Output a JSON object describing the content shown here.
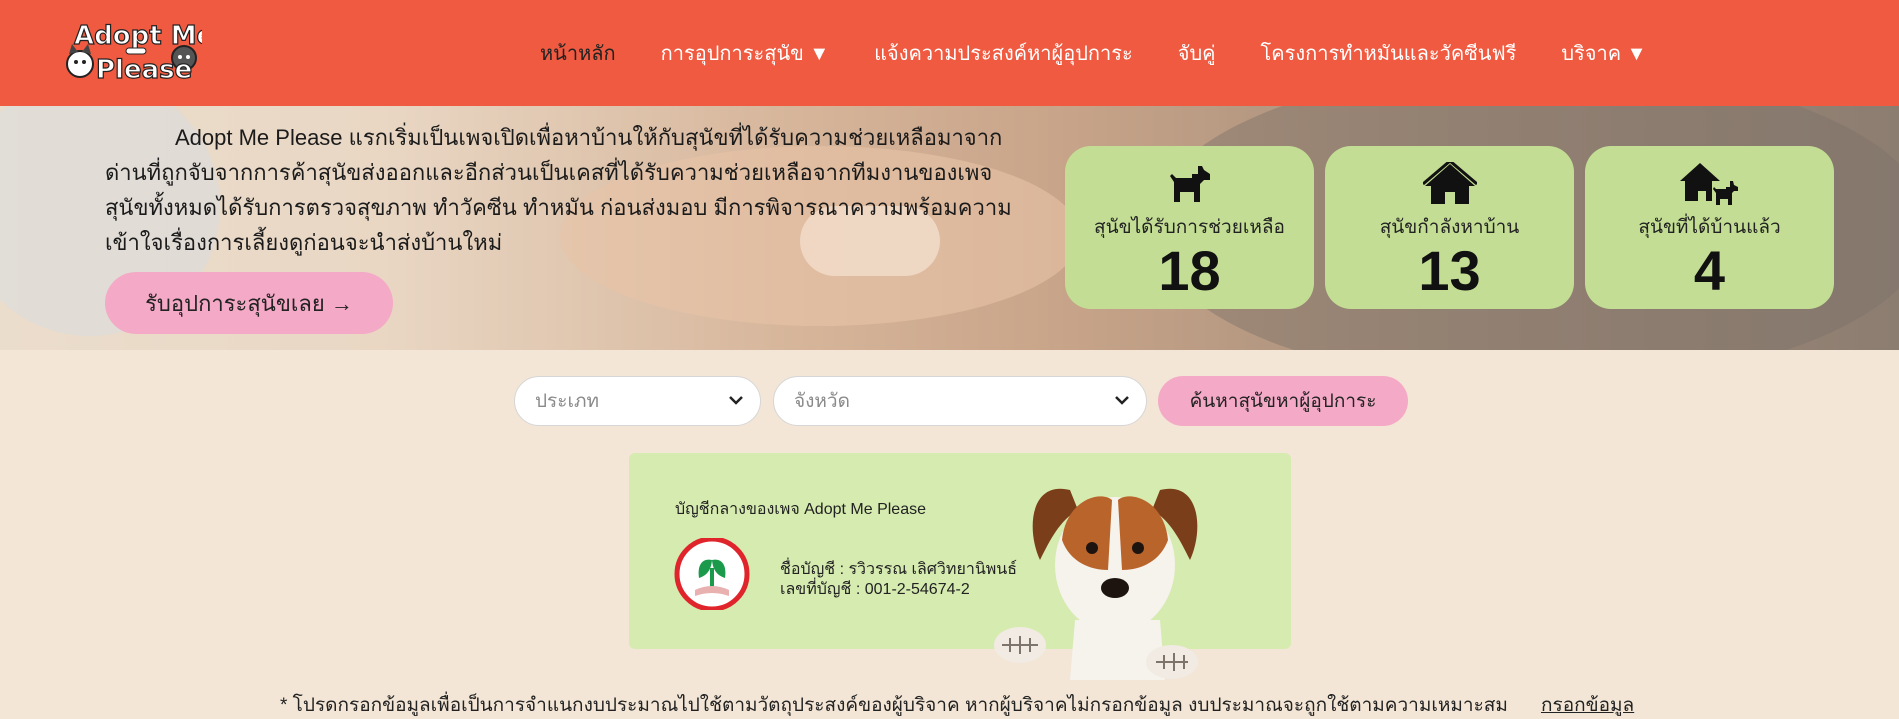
{
  "nav": {
    "logo_text": "Adopt Me Please",
    "items": [
      {
        "label": "หน้าหลัก",
        "active": true
      },
      {
        "label": "การอุปการะสุนัข ▼",
        "active": false
      },
      {
        "label": "แจ้งความประสงค์หาผู้อุปการะ",
        "active": false
      },
      {
        "label": "จับคู่",
        "active": false
      },
      {
        "label": "โครงการทำหมันและวัคซีนฟรี",
        "active": false
      },
      {
        "label": "บริจาค ▼",
        "active": false
      }
    ]
  },
  "hero": {
    "line1": "Adopt Me Please แรกเริ่มเป็นเพจเปิดเพื่อหาบ้านให้กับสุนัขที่ได้รับความช่วยเหลือมาจาก",
    "line2": "ด่านที่ถูกจับจากการค้าสุนัขส่งออกและอีกส่วนเป็นเคสที่ได้รับความช่วยเหลือจากทีมงานของเพจ",
    "line3": "สุนัขทั้งหมดได้รับการตรวจสุขภาพ ทำวัคซีน ทำหมัน ก่อนส่งมอบ มีการพิจารณาความพร้อมความ",
    "line4": "เข้าใจเรื่องการเลี้ยงดูก่อนจะนำส่งบ้านใหม่",
    "cta_label": "รับอุปการะสุนัขเลย →"
  },
  "stats": [
    {
      "icon": "dog-icon",
      "label": "สุนัขได้รับการช่วยเหลือ",
      "value": "18"
    },
    {
      "icon": "house-icon",
      "label": "สุนัขกำลังหาบ้าน",
      "value": "13"
    },
    {
      "icon": "house-dog-icon",
      "label": "สุนัขที่ได้บ้านแล้ว",
      "value": "4"
    }
  ],
  "search": {
    "type_placeholder": "ประเภท",
    "province_placeholder": "จังหวัด",
    "button_label": "ค้นหาสุนัขหาผู้อุปการะ"
  },
  "donation": {
    "title": "บัญชีกลางของเพจ Adopt Me Please",
    "account_name": "ชื่อบัญชี : รวิวรรณ เลิศวิทยานิพนธ์",
    "account_number": "เลขที่บัญชี : 001-2-54674-2"
  },
  "footer": {
    "note": "* โปรดกรอกข้อมูลเพื่อเป็นการจำแนกงบประมาณไปใช้ตามวัตถุประสงค์ของผู้บริจาค หากผู้บริจาคไม่กรอกข้อมูล งบประมาณจะถูกใช้ตามความเหมาะสม",
    "link_label": "กรอกข้อมูล"
  },
  "colors": {
    "navbar": "#ef5a40",
    "stat_card": "#c3de94",
    "pink_button": "#f4a9c6",
    "donation_card": "#d6ebb0",
    "page_bg": "#f3e6d6"
  }
}
